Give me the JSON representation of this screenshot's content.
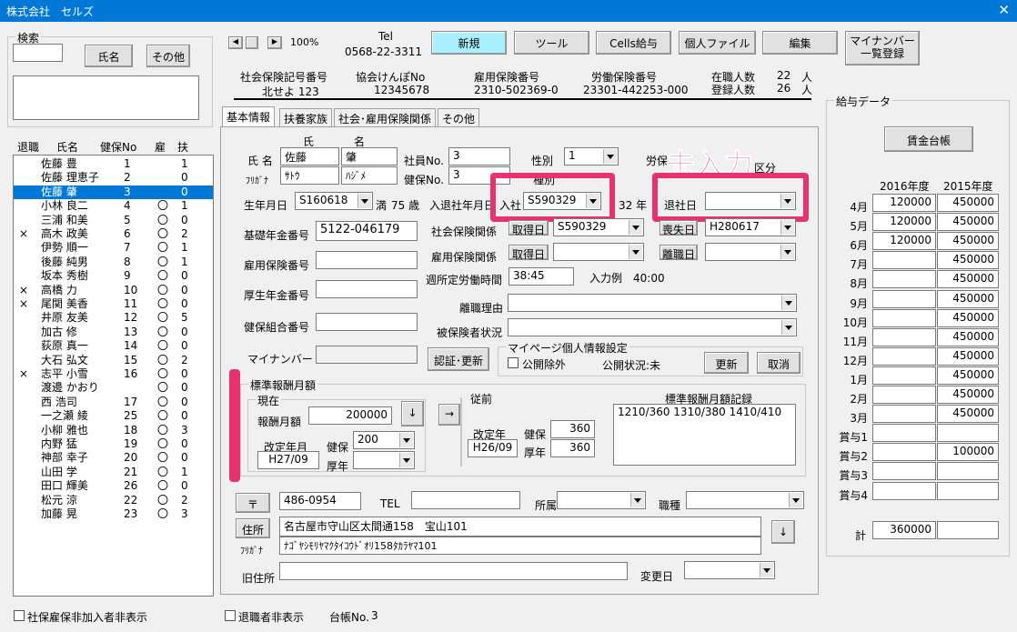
{
  "window": {
    "title": "株式会社　セルズ",
    "close": "✕"
  },
  "search": {
    "group": "検索",
    "name_btn": "氏名",
    "other_btn": "その他"
  },
  "list_header": {
    "retired": "退職",
    "name": "氏名",
    "health": "健保No",
    "emp": "雇",
    "dep": "扶"
  },
  "employees": [
    {
      "mark": "",
      "name": "佐藤 豊",
      "no": "1",
      "emp": "",
      "dep": "1"
    },
    {
      "mark": "",
      "name": "佐藤 理恵子",
      "no": "2",
      "emp": "",
      "dep": "0"
    },
    {
      "mark": "",
      "name": "佐藤 肇",
      "no": "3",
      "emp": "",
      "dep": "0"
    },
    {
      "mark": "",
      "name": "小林 良二",
      "no": "4",
      "emp": "〇",
      "dep": "1"
    },
    {
      "mark": "",
      "name": "三浦 和美",
      "no": "5",
      "emp": "〇",
      "dep": "0"
    },
    {
      "mark": "×",
      "name": "高木 政美",
      "no": "6",
      "emp": "〇",
      "dep": "2"
    },
    {
      "mark": "",
      "name": "伊勢 順一",
      "no": "7",
      "emp": "〇",
      "dep": "1"
    },
    {
      "mark": "",
      "name": "後藤 純男",
      "no": "8",
      "emp": "〇",
      "dep": "1"
    },
    {
      "mark": "",
      "name": "坂本 秀樹",
      "no": "9",
      "emp": "〇",
      "dep": "0"
    },
    {
      "mark": "×",
      "name": "高橋 力",
      "no": "10",
      "emp": "〇",
      "dep": "0"
    },
    {
      "mark": "×",
      "name": "尾関 美香",
      "no": "11",
      "emp": "〇",
      "dep": "0"
    },
    {
      "mark": "",
      "name": "井原 友美",
      "no": "12",
      "emp": "〇",
      "dep": "5"
    },
    {
      "mark": "",
      "name": "加古 修",
      "no": "13",
      "emp": "〇",
      "dep": "0"
    },
    {
      "mark": "",
      "name": "荻原 真一",
      "no": "14",
      "emp": "〇",
      "dep": "0"
    },
    {
      "mark": "",
      "name": "大石 弘文",
      "no": "15",
      "emp": "〇",
      "dep": "2"
    },
    {
      "mark": "×",
      "name": "志平 小雪",
      "no": "16",
      "emp": "〇",
      "dep": "0"
    },
    {
      "mark": "",
      "name": "渡邊 かおり",
      "no": "",
      "emp": "〇",
      "dep": "0"
    },
    {
      "mark": "",
      "name": "西 浩司",
      "no": "17",
      "emp": "〇",
      "dep": "0"
    },
    {
      "mark": "",
      "name": "一之瀬 綾",
      "no": "25",
      "emp": "〇",
      "dep": "0"
    },
    {
      "mark": "",
      "name": "小柳 雅也",
      "no": "18",
      "emp": "〇",
      "dep": "3"
    },
    {
      "mark": "",
      "name": "内野 猛",
      "no": "19",
      "emp": "〇",
      "dep": "0"
    },
    {
      "mark": "",
      "name": "神部 幸子",
      "no": "20",
      "emp": "〇",
      "dep": "0"
    },
    {
      "mark": "",
      "name": "山田 学",
      "no": "21",
      "emp": "〇",
      "dep": "1"
    },
    {
      "mark": "",
      "name": "田口 輝美",
      "no": "26",
      "emp": "〇",
      "dep": "0"
    },
    {
      "mark": "",
      "name": "松元 涼",
      "no": "22",
      "emp": "〇",
      "dep": "2"
    },
    {
      "mark": "",
      "name": "加藤 晃",
      "no": "23",
      "emp": "〇",
      "dep": "3"
    }
  ],
  "bottom": {
    "hide_social": "社保雇保非加入者非表示",
    "hide_retired": "退職者非表示",
    "ledger_label": "台帳No.",
    "ledger_no": "3"
  },
  "toolbar": {
    "zoom": "100%",
    "tel_label": "Tel",
    "tel": "0568-22-3311",
    "new": "新規",
    "tool": "ツール",
    "cells": "Cells給与",
    "personal": "個人ファイル",
    "edit": "編集",
    "mynumber": "マイナンバー",
    "mynumber2": "一覧登録"
  },
  "info": {
    "social_label": "社会保険記号番号",
    "social_val": "北せよ 123",
    "kyokai_label": "協会けんぽNo",
    "kyokai_val": "12345678",
    "koyo_label": "雇用保険番号",
    "koyo_val": "2310-502369-0",
    "rodo_label": "労働保険番号",
    "rodo_val": "23301-442253-000",
    "zaishoku_label": "在職人数",
    "zaishoku_val": "22",
    "touroku_label": "登録人数",
    "touroku_val": "26",
    "unit": "人"
  },
  "tabs": [
    "基本情報",
    "扶養家族",
    "社会･雇用保険関係",
    "その他"
  ],
  "form": {
    "name_label": "氏 名",
    "furigana_label": "ﾌﾘｶﾞﾅ",
    "shi": "氏",
    "mei": "名",
    "last": "佐藤",
    "first": "肇",
    "last_kana": "ｻﾄｳ",
    "first_kana": "ﾊｼﾞﾒ",
    "empno_label": "社員No.",
    "empno": "3",
    "healthno_label": "健保No.",
    "healthno": "3",
    "gender_label": "性別",
    "gender": "1",
    "kind_label": "種別",
    "rohonum_label": "労保",
    "zone_label": "区分",
    "overlay": "未入力",
    "birth_label": "生年月日",
    "birth": "S160618",
    "age_prefix": "満",
    "age": "75 歳",
    "inout_label": "入退社年月日",
    "join_label": "入社",
    "join": "S590329",
    "tenure": "32 年",
    "retire_label": "退社日",
    "retire": "",
    "pension_label": "基礎年金番号",
    "pension": "5122-046179",
    "social_rel": "社会保険関係",
    "acquire": "取得日",
    "acquire_val": "S590329",
    "loss": "喪失日",
    "loss_val": "H280617",
    "koyo_rel": "雇用保険関係",
    "acquire2": "取得日",
    "leave": "離職日",
    "koyo_no_label": "雇用保険番号",
    "weekly_label": "週所定労働時間",
    "weekly": "38:45",
    "weekly_eg": "入力例　40:00",
    "kosei_label": "厚生年金番号",
    "ritoku_label": "離職理由",
    "kumiai_label": "健保組合番号",
    "hihokensha_label": "被保険者状況",
    "mynum_label": "マイナンバー",
    "auth_btn": "認証･更新",
    "mypage_group": "マイページ個人情報設定",
    "public_exclude": "公開除外",
    "public_status": "公開状況:未",
    "update_btn": "更新",
    "cancel_btn": "取消"
  },
  "std": {
    "group": "標準報酬月額",
    "current": "現在",
    "monthly_label": "報酬月額",
    "monthly": "200000",
    "down": "↓",
    "right": "→",
    "revision_label": "改定年月",
    "revision": "H27/09",
    "kenpo_label": "健保",
    "kenpo": "200",
    "kosei_label": "厚年",
    "before": "従前",
    "before_rev_label": "改定年",
    "before_rev": "H26/09",
    "before_kenpo_label": "健保",
    "before_kenpo": "360",
    "before_kosei_label": "厚年",
    "before_kosei": "360",
    "record_label": "標準報酬月額記録",
    "record": "1210/360 1310/380 1410/410"
  },
  "address": {
    "zip_btn": "〒",
    "zip": "486-0954",
    "tel_label": "TEL",
    "dept_label": "所属",
    "job_label": "職種",
    "addr_btn": "住所",
    "addr": "名古屋市守山区太間通158　宝山101",
    "furigana_label": "ﾌﾘｶﾞﾅ",
    "addr_kana": "ﾅｺﾞﾔｼﾓﾘﾔﾏｸﾀｲｺｳﾄﾞｵﾘ158ﾀｶﾗﾔﾏ101",
    "down": "↓",
    "old_label": "旧住所",
    "change_label": "変更日"
  },
  "salary": {
    "group": "給与データ",
    "ledger_btn": "賃金台帳",
    "years": [
      "2016年度",
      "2015年度"
    ],
    "rows": [
      {
        "m": "4月",
        "a": "120000",
        "b": "450000"
      },
      {
        "m": "5月",
        "a": "120000",
        "b": "450000"
      },
      {
        "m": "6月",
        "a": "120000",
        "b": "450000"
      },
      {
        "m": "7月",
        "a": "",
        "b": "450000"
      },
      {
        "m": "8月",
        "a": "",
        "b": "450000"
      },
      {
        "m": "9月",
        "a": "",
        "b": "450000"
      },
      {
        "m": "10月",
        "a": "",
        "b": "450000"
      },
      {
        "m": "11月",
        "a": "",
        "b": "450000"
      },
      {
        "m": "12月",
        "a": "",
        "b": "450000"
      },
      {
        "m": "1月",
        "a": "",
        "b": "450000"
      },
      {
        "m": "2月",
        "a": "",
        "b": "450000"
      },
      {
        "m": "3月",
        "a": "",
        "b": "450000"
      },
      {
        "m": "賞与1",
        "a": "",
        "b": ""
      },
      {
        "m": "賞与2",
        "a": "",
        "b": "100000"
      },
      {
        "m": "賞与3",
        "a": "",
        "b": ""
      },
      {
        "m": "賞与4",
        "a": "",
        "b": ""
      }
    ],
    "total_label": "計",
    "total": "360000"
  },
  "colors": {
    "title_bar": "#0078d7",
    "selected_row": "#0078d7",
    "highlight_button": "#a8f0ff",
    "annotation": "#e8326d"
  }
}
